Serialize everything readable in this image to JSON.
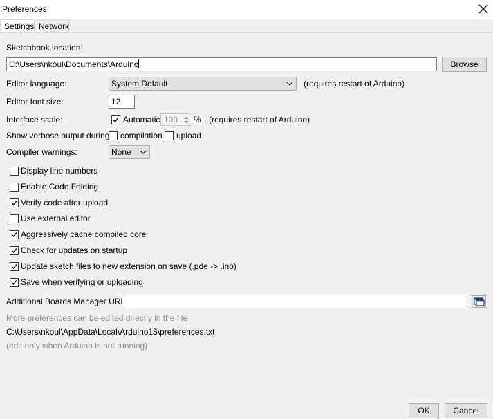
{
  "window": {
    "title": "Preferences"
  },
  "tabs": [
    {
      "label": "Settings",
      "active": true
    },
    {
      "label": "Network",
      "active": false
    }
  ],
  "sketchbook": {
    "label": "Sketchbook location:",
    "value": "C:\\Users\\nkoul\\Documents\\Arduino",
    "browse_label": "Browse"
  },
  "language": {
    "label": "Editor language:",
    "value": "System Default",
    "note": "(requires restart of Arduino)"
  },
  "font_size": {
    "label": "Editor font size:",
    "value": "12"
  },
  "interface_scale": {
    "label": "Interface scale:",
    "automatic_label": "Automatic",
    "automatic_checked": true,
    "value": "100",
    "unit": "%",
    "note": "(requires restart of Arduino)"
  },
  "verbose": {
    "label": "Show verbose output during:",
    "compilation_label": "compilation",
    "compilation_checked": false,
    "upload_label": "upload",
    "upload_checked": false
  },
  "warnings": {
    "label": "Compiler warnings:",
    "value": "None"
  },
  "options": [
    {
      "label": "Display line numbers",
      "checked": false
    },
    {
      "label": "Enable Code Folding",
      "checked": false
    },
    {
      "label": "Verify code after upload",
      "checked": true
    },
    {
      "label": "Use external editor",
      "checked": false
    },
    {
      "label": "Aggressively cache compiled core",
      "checked": true
    },
    {
      "label": "Check for updates on startup",
      "checked": true
    },
    {
      "label": "Update sketch files to new extension on save (.pde -> .ino)",
      "checked": true
    },
    {
      "label": "Save when verifying or uploading",
      "checked": true
    }
  ],
  "boards": {
    "label": "Additional Boards Manager URLs:",
    "value": ""
  },
  "info": {
    "more_prefs": "More preferences can be edited directly in the file",
    "path": "C:\\Users\\nkoul\\AppData\\Local\\Arduino15\\preferences.txt",
    "edit_note": "(edit only when Arduino is not running)"
  },
  "footer": {
    "ok_label": "OK",
    "cancel_label": "Cancel"
  },
  "colors": {
    "window_bg": "#f0f0f0",
    "field_bg": "#ffffff",
    "button_bg": "#e1e1e1",
    "muted_text": "#8c8c8c"
  },
  "icons": {
    "close": "close-icon",
    "dropdown": "chevron-down-icon",
    "check": "checkmark-icon",
    "boards": "window-list-icon"
  }
}
